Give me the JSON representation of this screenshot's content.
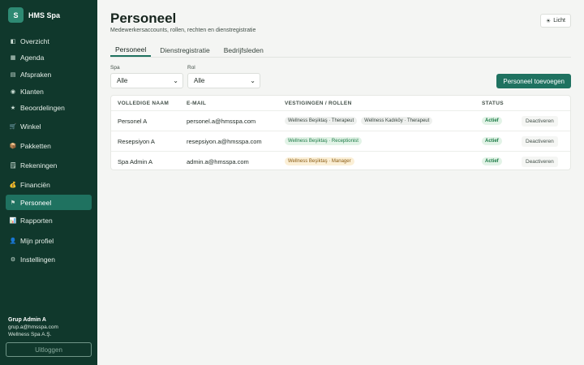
{
  "brand": {
    "logo_letter": "S",
    "name": "HMS Spa"
  },
  "sidebar": {
    "items": [
      {
        "label": "Overzicht",
        "icon": "◧"
      },
      {
        "label": "Agenda",
        "icon": "▦"
      },
      {
        "label": "Afspraken",
        "icon": "▤"
      },
      {
        "label": "Klanten",
        "icon": "◉"
      },
      {
        "label": "Beoordelingen",
        "icon": "★"
      },
      {
        "label": "Winkel",
        "icon": "🛒"
      },
      {
        "label": "Pakketten",
        "icon": "📦"
      },
      {
        "label": "Rekeningen",
        "icon": "🗒"
      },
      {
        "label": "Financiën",
        "icon": "💰"
      },
      {
        "label": "Personeel",
        "icon": "⚑"
      },
      {
        "label": "Rapporten",
        "icon": "📊"
      },
      {
        "label": "Mijn profiel",
        "icon": "👤"
      },
      {
        "label": "Instellingen",
        "icon": "⚙"
      }
    ],
    "active_index": 9
  },
  "user": {
    "name": "Grup Admin A",
    "email": "grup.a@hmsspa.com",
    "company": "Wellness Spa A.Ş.",
    "logout_label": "Uitloggen"
  },
  "header": {
    "title": "Personeel",
    "subtitle": "Medewerkersaccounts, rollen, rechten en dienstregistratie",
    "theme_icon": "☀",
    "theme_label": "Licht"
  },
  "tabs": [
    {
      "label": "Personeel"
    },
    {
      "label": "Dienstregistratie"
    },
    {
      "label": "Bedrijfsleden"
    }
  ],
  "filters": {
    "spa": {
      "label": "Spa",
      "value": "Alle"
    },
    "rol": {
      "label": "Rol",
      "value": "Alle"
    }
  },
  "add_button": "Personeel toevoegen",
  "table": {
    "headers": {
      "name": "VOLLEDIGE NAAM",
      "email": "E-MAIL",
      "roles": "VESTIGINGEN / ROLLEN",
      "status": "STATUS"
    },
    "rows": [
      {
        "name": "Personel A",
        "email": "personel.a@hmsspa.com",
        "roles": [
          {
            "text": "Wellness Beşiktaş · Therapeut",
            "tone": "neutral"
          },
          {
            "text": "Wellness Kadıköy · Therapeut",
            "tone": "neutral"
          }
        ],
        "status": "Actief",
        "action": "Deactiveren"
      },
      {
        "name": "Resepsiyon A",
        "email": "resepsiyon.a@hmsspa.com",
        "roles": [
          {
            "text": "Wellness Beşiktaş · Receptionist",
            "tone": "green"
          }
        ],
        "status": "Actief",
        "action": "Deactiveren"
      },
      {
        "name": "Spa Admin A",
        "email": "admin.a@hmsspa.com",
        "roles": [
          {
            "text": "Wellness Beşiktaş · Manager",
            "tone": "amber"
          }
        ],
        "status": "Actief",
        "action": "Deactiveren"
      }
    ]
  }
}
